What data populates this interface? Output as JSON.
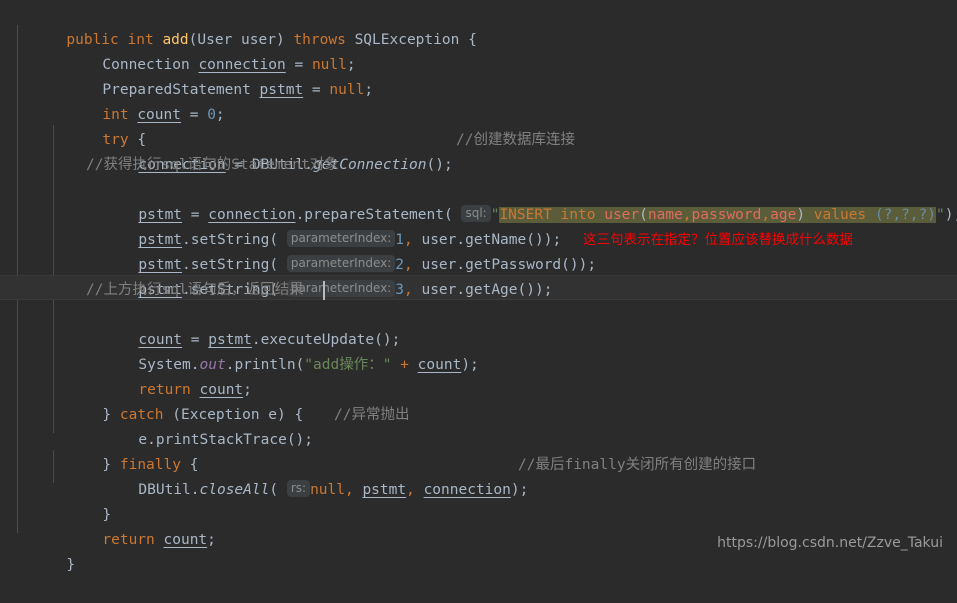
{
  "editor": {
    "theme": "darcula",
    "background_color": "#2b2b2b",
    "current_line_color": "#323232",
    "default_text_color": "#a9b7c6",
    "keyword_color": "#cc7832",
    "string_color": "#6a8759",
    "number_color": "#6897bb",
    "comment_color": "#808080",
    "field_color": "#9876aa",
    "method_decl_color": "#ffc66d",
    "annotation_color": "#ff0000",
    "hint_background_color": "#3c3f41",
    "hint_text_color": "#8c8c8c",
    "sql_injection_background_color": "#5b5c39",
    "caret_color": "#bbbbbb",
    "language": "Java",
    "line_count": 19,
    "current_line_number": 11
  },
  "code": {
    "line1": {
      "kw_public": "public",
      "kw_int": "int",
      "method_name": "add",
      "paren_open": "(",
      "param_type": "User",
      "param_name": " user",
      "paren_close": ")",
      "kw_throws": "throws",
      "exception_type": "SQLException",
      "brace": "{"
    },
    "line2": {
      "type": "Connection",
      "var": "connection",
      "assign": " = ",
      "kw_null": "null",
      "semi": ";"
    },
    "line3": {
      "type": "PreparedStatement",
      "var": "pstmt",
      "assign": " = ",
      "kw_null": "null",
      "semi": ";"
    },
    "line4": {
      "kw_int": "int",
      "var": "count",
      "assign": " = ",
      "value": "0",
      "semi": ";"
    },
    "line5": {
      "kw_try": "try",
      "brace": "{"
    },
    "line6": {
      "var": "connection",
      "assign": " = ",
      "class": "DBUtil",
      "dot": ".",
      "method": "getConnection",
      "call": "()",
      "semi": ";",
      "comment": "//创建数据库连接"
    },
    "line7": {
      "comment": "//获得执行sql语句的Statement对象"
    },
    "line8": {
      "var": "pstmt",
      "assign": " = ",
      "obj": "connection",
      "dot": ".",
      "method": "prepareStatement",
      "paren_open": "( ",
      "hint": "sql:",
      "quote_open": "\"",
      "sql_insert": "INSERT",
      "sql_into": " into ",
      "sql_table": "user",
      "sql_paren_open": "(",
      "sql_col1": "name",
      "sql_comma1": ",",
      "sql_col2": "password",
      "sql_comma2": ",",
      "sql_col3": "age",
      "sql_paren_close": ")",
      "sql_values": " values ",
      "sql_params": "(?,?,?)",
      "quote_close": "\"",
      "paren_close": ")",
      "semi": ";"
    },
    "line9": {
      "var": "pstmt",
      "dot": ".",
      "method": "setString",
      "paren_open": "( ",
      "hint": "parameterIndex:",
      "index": "1",
      "comma": ", ",
      "arg_obj": "user",
      "arg_dot": ".",
      "arg_method": "getName",
      "call": "()",
      "paren_close": ")",
      "semi": ";"
    },
    "line10": {
      "var": "pstmt",
      "dot": ".",
      "method": "setString",
      "paren_open": "( ",
      "hint": "parameterIndex:",
      "index": "2",
      "comma": ", ",
      "arg_obj": "user",
      "arg_dot": ".",
      "arg_method": "getPassword",
      "call": "()",
      "paren_close": ")",
      "semi": ";",
      "annotation": "这三句表示在指定？位置应该替换成什么数据"
    },
    "line11": {
      "var": "pstmt",
      "dot": ".",
      "method": "setString",
      "paren_open": "( ",
      "hint": "parameterIndex:",
      "index": "3",
      "comma": ", ",
      "arg_obj": "user",
      "arg_dot": ".",
      "arg_method": "getAge",
      "call": "()",
      "paren_close": ")",
      "semi": ";"
    },
    "line12": {
      "comment": "//上方执行sql语句后，返回结果"
    },
    "line13": {
      "var": "count",
      "assign": " = ",
      "obj": "pstmt",
      "dot": ".",
      "method": "executeUpdate",
      "call": "()",
      "semi": ";"
    },
    "line14": {
      "class": "System",
      "dot1": ".",
      "field": "out",
      "dot2": ".",
      "method": "println",
      "paren_open": "(",
      "string": "\"add操作：\"",
      "plus": " + ",
      "var": "count",
      "paren_close": ")",
      "semi": ";"
    },
    "line15": {
      "kw_return": "return",
      "var": "count",
      "semi": ";"
    },
    "line16": {
      "brace_close": "} ",
      "kw_catch": "catch",
      "paren_open": " (",
      "type": "Exception",
      "var": " e",
      "paren_close": ")",
      "brace": " {"
    },
    "line17": {
      "obj": "e",
      "dot": ".",
      "method": "printStackTrace",
      "call": "()",
      "semi": ";",
      "comment": "//异常抛出"
    },
    "line18": {
      "brace_close": "} ",
      "kw_finally": "finally",
      "brace": " {"
    },
    "line19": {
      "class": "DBUtil",
      "dot": ".",
      "method": "closeAll",
      "paren_open": "( ",
      "hint": "rs:",
      "kw_null": "null",
      "comma1": ", ",
      "arg2": "pstmt",
      "comma2": ", ",
      "arg3": "connection",
      "paren_close": ")",
      "semi": ";",
      "comment": "//最后finally关闭所有创建的接口"
    },
    "line20": {
      "brace_close": "}"
    },
    "line21": {
      "kw_return": "return",
      "var": "count",
      "semi": ";"
    },
    "line22": {
      "brace_close": "}"
    }
  },
  "watermark": {
    "url": "https://blog.csdn.net/Zzve_Takui"
  }
}
